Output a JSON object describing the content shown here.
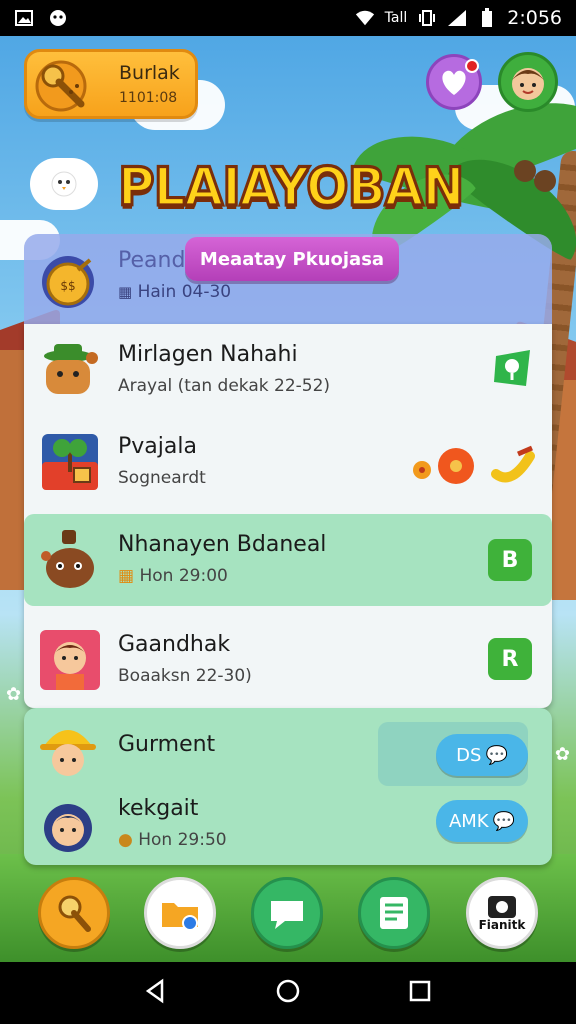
{
  "status_bar": {
    "time": "2:056",
    "carrier": "Tall"
  },
  "header": {
    "pill": {
      "title": "Burlak",
      "subtitle": "1101:08"
    },
    "game_title": "PLAIAYOBAN"
  },
  "banner": {
    "title": "Peand",
    "subtitle": "Hain 04-30",
    "promo_label": "Meaatay Pkuojasa"
  },
  "list": {
    "items": [
      {
        "title": "Mirlagen Nahahi",
        "subtitle": "Arayal (tan dekak 22-52)"
      },
      {
        "title": "Pvajala",
        "subtitle": "Sogneardt"
      },
      {
        "title": "Nhanayen Bdaneal",
        "subtitle": "Hon 29:00",
        "button": "B"
      },
      {
        "title": "Gaandhak",
        "subtitle": "Boaaksn 22-30)",
        "button": "R"
      }
    ]
  },
  "friends": {
    "items": [
      {
        "title": "Gurment",
        "chip": "DS"
      },
      {
        "title": "kekgait",
        "subtitle": "Hon 29:50",
        "chip": "AMK"
      }
    ]
  },
  "dock": {
    "items": [
      {
        "icon": "horn-icon",
        "color": "#f5a623"
      },
      {
        "icon": "folder-icon",
        "color": "#ffffff"
      },
      {
        "icon": "chat-icon",
        "color": "#35b765"
      },
      {
        "icon": "list-icon",
        "color": "#35b765"
      },
      {
        "icon": "camera-icon",
        "color": "#ffffff",
        "label": "Fianitk"
      }
    ]
  }
}
